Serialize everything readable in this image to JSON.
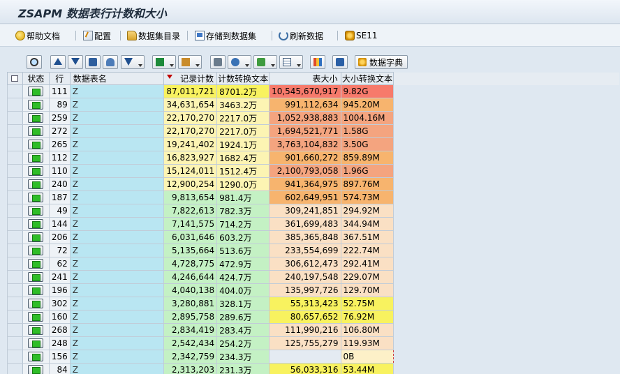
{
  "window": {
    "title": "ZSAPM 数据表行计数和大小"
  },
  "appbar": {
    "buttons": [
      {
        "label": "帮助文档",
        "icon": "help-icon"
      },
      {
        "label": "配置",
        "icon": "config-icon"
      },
      {
        "label": "数据集目录",
        "icon": "dataset-directory-icon"
      },
      {
        "label": "存储到数据集",
        "icon": "store-to-dataset-icon"
      },
      {
        "label": "刷新数据",
        "icon": "refresh-icon"
      },
      {
        "label": "SE11",
        "icon": "se11-icon"
      }
    ]
  },
  "alv_toolbar": {
    "dictionary_label": "数据字典"
  },
  "grid": {
    "columns": {
      "status": "状态",
      "row": "行",
      "name": "数据表名",
      "records": "记录计数",
      "records_text": "计数转换文本",
      "size": "表大小",
      "size_text": "大小转换文本"
    },
    "sorted_column": "records",
    "colors": {
      "red": "#f77a6b",
      "salmon": "#f4a47f",
      "orange": "#f7b46e",
      "yellow": "#f8f25f",
      "lightyellow": "#fcf4b3",
      "green": "#c4f1c4",
      "peach": "#fae0c4",
      "blank": "#e4ebf2"
    },
    "rows": [
      {
        "row": "111",
        "name": "Z",
        "records": "87,011,721",
        "records_text": "8701.2万",
        "size": "10,545,670,917",
        "size_text": "9.82G",
        "rc": "yellow",
        "sc": "red"
      },
      {
        "row": "89",
        "name": "Z",
        "records": "34,631,654",
        "records_text": "3463.2万",
        "size": "991,112,634",
        "size_text": "945.20M",
        "rc": "lightyellow",
        "sc": "orange"
      },
      {
        "row": "259",
        "name": "Z",
        "records": "22,170,270",
        "records_text": "2217.0万",
        "size": "1,052,938,883",
        "size_text": "1004.16M",
        "rc": "lightyellow",
        "sc": "salmon"
      },
      {
        "row": "272",
        "name": "Z",
        "records": "22,170,270",
        "records_text": "2217.0万",
        "size": "1,694,521,771",
        "size_text": "1.58G",
        "rc": "lightyellow",
        "sc": "salmon"
      },
      {
        "row": "265",
        "name": "Z",
        "records": "19,241,402",
        "records_text": "1924.1万",
        "size": "3,763,104,832",
        "size_text": "3.50G",
        "rc": "lightyellow",
        "sc": "salmon"
      },
      {
        "row": "112",
        "name": "Z",
        "records": "16,823,927",
        "records_text": "1682.4万",
        "size": "901,660,272",
        "size_text": "859.89M",
        "rc": "lightyellow",
        "sc": "orange"
      },
      {
        "row": "110",
        "name": "Z",
        "records": "15,124,011",
        "records_text": "1512.4万",
        "size": "2,100,793,058",
        "size_text": "1.96G",
        "rc": "lightyellow",
        "sc": "salmon"
      },
      {
        "row": "240",
        "name": "Z",
        "records": "12,900,254",
        "records_text": "1290.0万",
        "size": "941,364,975",
        "size_text": "897.76M",
        "rc": "lightyellow",
        "sc": "orange"
      },
      {
        "row": "187",
        "name": "Z",
        "records": "9,813,654",
        "records_text": "981.4万",
        "size": "602,649,951",
        "size_text": "574.73M",
        "rc": "green",
        "sc": "orange"
      },
      {
        "row": "49",
        "name": "Z",
        "records": "7,822,613",
        "records_text": "782.3万",
        "size": "309,241,851",
        "size_text": "294.92M",
        "rc": "green",
        "sc": "peach"
      },
      {
        "row": "144",
        "name": "Z",
        "records": "7,141,575",
        "records_text": "714.2万",
        "size": "361,699,483",
        "size_text": "344.94M",
        "rc": "green",
        "sc": "peach"
      },
      {
        "row": "206",
        "name": "Z",
        "records": "6,031,646",
        "records_text": "603.2万",
        "size": "385,365,848",
        "size_text": "367.51M",
        "rc": "green",
        "sc": "peach"
      },
      {
        "row": "72",
        "name": "Z",
        "records": "5,135,664",
        "records_text": "513.6万",
        "size": "233,554,699",
        "size_text": "222.74M",
        "rc": "green",
        "sc": "peach"
      },
      {
        "row": "62",
        "name": "Z",
        "records": "4,728,775",
        "records_text": "472.9万",
        "size": "306,612,473",
        "size_text": "292.41M",
        "rc": "green",
        "sc": "peach"
      },
      {
        "row": "241",
        "name": "Z",
        "records": "4,246,644",
        "records_text": "424.7万",
        "size": "240,197,548",
        "size_text": "229.07M",
        "rc": "green",
        "sc": "peach"
      },
      {
        "row": "196",
        "name": "Z",
        "records": "4,040,138",
        "records_text": "404.0万",
        "size": "135,997,726",
        "size_text": "129.70M",
        "rc": "green",
        "sc": "peach"
      },
      {
        "row": "302",
        "name": "Z",
        "records": "3,280,881",
        "records_text": "328.1万",
        "size": "55,313,423",
        "size_text": "52.75M",
        "rc": "green",
        "sc": "yellow"
      },
      {
        "row": "160",
        "name": "Z",
        "records": "2,895,758",
        "records_text": "289.6万",
        "size": "80,657,652",
        "size_text": "76.92M",
        "rc": "green",
        "sc": "yellow"
      },
      {
        "row": "268",
        "name": "Z",
        "records": "2,834,419",
        "records_text": "283.4万",
        "size": "111,990,216",
        "size_text": "106.80M",
        "rc": "green",
        "sc": "peach"
      },
      {
        "row": "248",
        "name": "Z",
        "records": "2,542,434",
        "records_text": "254.2万",
        "size": "125,755,279",
        "size_text": "119.93M",
        "rc": "green",
        "sc": "peach"
      },
      {
        "row": "156",
        "name": "Z",
        "records": "2,342,759",
        "records_text": "234.3万",
        "size": "",
        "size_text": "0B",
        "rc": "green",
        "sc": "blank"
      },
      {
        "row": "84",
        "name": "Z",
        "records": "2,313,203",
        "records_text": "231.3万",
        "size": "56,033,316",
        "size_text": "53.44M",
        "rc": "green",
        "sc": "yellow"
      }
    ]
  }
}
